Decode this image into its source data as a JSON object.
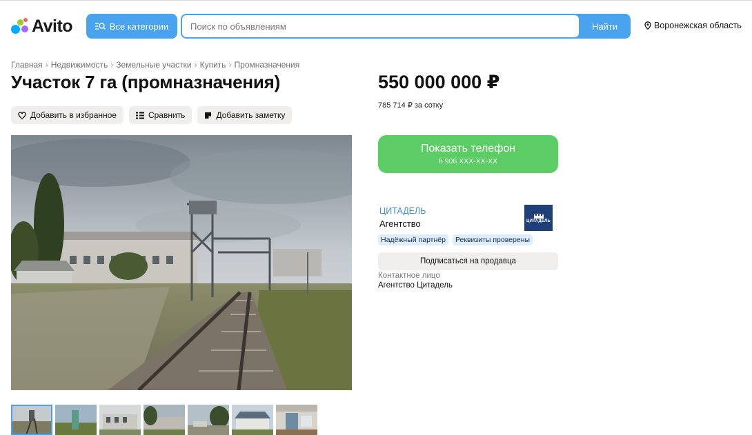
{
  "header": {
    "logo_text": "Avito",
    "categories_label": "Все категории",
    "search_placeholder": "Поиск по объявлениям",
    "search_button": "Найти",
    "region": "Воронежская область"
  },
  "breadcrumb": [
    "Главная",
    "Недвижимость",
    "Земельные участки",
    "Купить",
    "Промназначения"
  ],
  "listing": {
    "title": "Участок 7 га (промназначения)",
    "actions": {
      "favorite": "Добавить в избранное",
      "compare": "Сравнить",
      "note": "Добавить заметку"
    },
    "photo_alt": "Участок с железнодорожной веткой и промышленными постройками",
    "thumbnail_count": 7
  },
  "pricing": {
    "price": "550 000 000 ₽",
    "per_unit": "785 714 ₽ за сотку"
  },
  "contact": {
    "phone_button": "Показать телефон",
    "phone_masked": "8 906 XXX-XX-XX"
  },
  "seller": {
    "name": "ЦИТАДЕЛЬ",
    "type": "Агентство",
    "logo_text": "ЦИТАДЕЛЬ",
    "badges": [
      "Надёжный партнёр",
      "Реквизиты проверены"
    ],
    "subscribe_button": "Подписаться на продавца",
    "contact_label": "Контактное лицо",
    "contact_name": "Агентство Цитадель"
  },
  "colors": {
    "brand_blue": "#4aa3ef",
    "phone_green": "#5ccd64",
    "seller_link": "#3f8fdc",
    "badge_bg": "#ddeefe",
    "neutral_btn": "#f1efed"
  },
  "icons": {
    "categories": "search-list-icon",
    "region": "location-pin-icon",
    "favorite": "heart-icon",
    "compare": "compare-icon",
    "note": "note-icon"
  }
}
